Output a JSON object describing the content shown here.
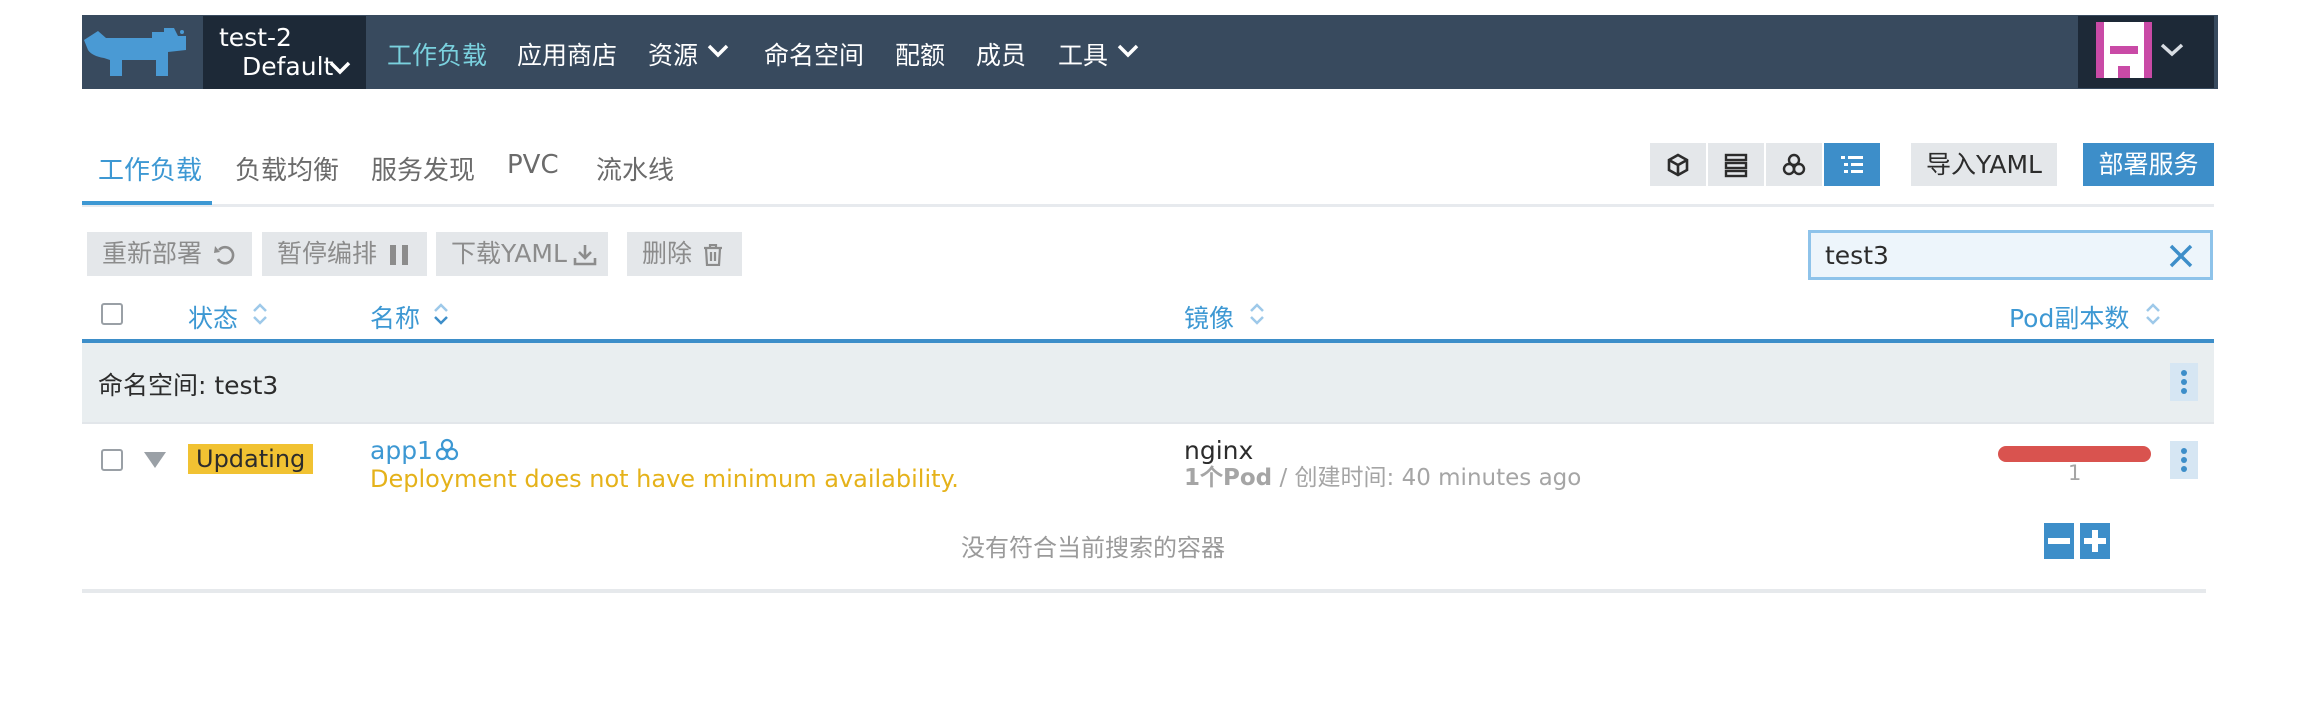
{
  "header": {
    "cluster": "test-2",
    "project": "Default",
    "nav": [
      {
        "label": "工作负载",
        "active": true
      },
      {
        "label": "应用商店"
      },
      {
        "label": "资源",
        "dropdown": true
      },
      {
        "label": "命名空间"
      },
      {
        "label": "配额"
      },
      {
        "label": "成员"
      },
      {
        "label": "工具",
        "dropdown": true
      }
    ]
  },
  "tabs": [
    "工作负载",
    "负载均衡",
    "服务发现",
    "PVC",
    "流水线"
  ],
  "toolbar": {
    "view_icons": [
      "cube-icon",
      "server-icon",
      "cluster-icon",
      "list-icon"
    ],
    "import_label": "导入YAML",
    "deploy_label": "部署服务"
  },
  "bulk_actions": {
    "redeploy": "重新部署",
    "pause": "暂停编排",
    "download": "下载YAML",
    "delete": "删除"
  },
  "search": {
    "value": "test3"
  },
  "table": {
    "columns": {
      "state": "状态",
      "name": "名称",
      "image": "镜像",
      "pods": "Pod副本数"
    },
    "namespace_group": "命名空间: test3",
    "rows": [
      {
        "state": "Updating",
        "name": "app1",
        "message": "Deployment does not have minimum availability.",
        "image": "nginx",
        "pod_count": "1个Pod",
        "separator": "/",
        "created": "创建时间: 40 minutes ago",
        "scale": "1"
      }
    ],
    "empty_message": "没有符合当前搜索的容器"
  },
  "colors": {
    "topbar": "#384a5e",
    "accent": "#3d8ec9",
    "active_nav": "#7ad1de",
    "updating_badge": "#f1c232",
    "warning_text": "#e5b21a",
    "scale_bar": "#d9534f"
  }
}
